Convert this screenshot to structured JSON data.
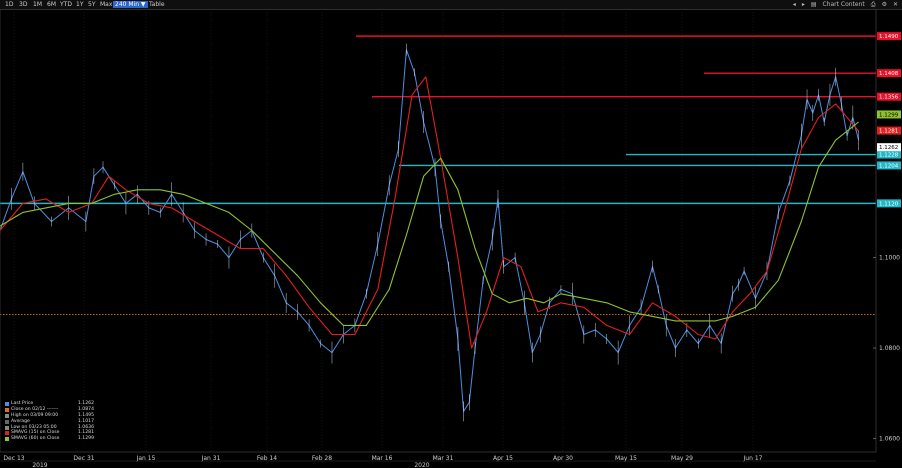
{
  "toolbar": {
    "ranges": [
      "1D",
      "3D",
      "1M",
      "6M",
      "YTD",
      "1Y",
      "5Y",
      "Max",
      "240 Min ▼",
      "Table"
    ],
    "active_range": "240 Min ▼",
    "chart_content_label": "Chart Content"
  },
  "colors": {
    "price": "#4c8fe0",
    "sma15": "#e02020",
    "sma60": "#8fc22f",
    "resistance": "#e8102a",
    "support": "#20b8c8",
    "close_ref": "#e07020"
  },
  "chart_data": {
    "type": "line",
    "x_tick_labels": [
      "Dec 13",
      "Dec 31",
      "Jan 15",
      "Jan 31",
      "Feb 14",
      "Feb 28",
      "Mar 16",
      "Mar 31",
      "Apr 15",
      "Apr 30",
      "May 15",
      "May 29",
      "Jun 17"
    ],
    "year_labels": [
      "2019",
      "2020"
    ],
    "y_tick_labels": [
      "1.1000",
      "1.0800",
      "1.0600"
    ],
    "ylim": [
      1.057,
      1.155
    ],
    "close_reference": 1.0874,
    "horizontal_levels": [
      {
        "value": 1.149,
        "label": "1.1490",
        "kind": "resistance"
      },
      {
        "value": 1.1408,
        "label": "1.1408",
        "kind": "resistance"
      },
      {
        "value": 1.1356,
        "label": "1.1356",
        "kind": "resistance"
      },
      {
        "value": 1.1228,
        "label": "1.1228",
        "kind": "support"
      },
      {
        "value": 1.1204,
        "label": "1.1204",
        "kind": "support"
      },
      {
        "value": 1.112,
        "label": "1.1120",
        "kind": "support"
      }
    ],
    "badges": [
      {
        "value": 1.1299,
        "label": "1.1299",
        "kind": "sma60"
      },
      {
        "value": 1.1281,
        "label": "1.1281",
        "kind": "sma15"
      },
      {
        "value": 1.1262,
        "label": "1.1262",
        "kind": "last"
      }
    ],
    "series": [
      {
        "name": "Last Price",
        "points": [
          [
            0,
            1.106
          ],
          [
            10,
            1.113
          ],
          [
            20,
            1.119
          ],
          [
            30,
            1.112
          ],
          [
            45,
            1.108
          ],
          [
            60,
            1.111
          ],
          [
            75,
            1.108
          ],
          [
            82,
            1.118
          ],
          [
            90,
            1.12
          ],
          [
            100,
            1.116
          ],
          [
            110,
            1.112
          ],
          [
            120,
            1.114
          ],
          [
            130,
            1.111
          ],
          [
            140,
            1.11
          ],
          [
            150,
            1.114
          ],
          [
            160,
            1.11
          ],
          [
            170,
            1.106
          ],
          [
            180,
            1.104
          ],
          [
            190,
            1.103
          ],
          [
            200,
            1.1
          ],
          [
            210,
            1.104
          ],
          [
            220,
            1.106
          ],
          [
            230,
            1.1
          ],
          [
            240,
            1.096
          ],
          [
            250,
            1.09
          ],
          [
            260,
            1.088
          ],
          [
            270,
            1.085
          ],
          [
            280,
            1.081
          ],
          [
            290,
            1.079
          ],
          [
            300,
            1.083
          ],
          [
            310,
            1.085
          ],
          [
            320,
            1.092
          ],
          [
            330,
            1.103
          ],
          [
            340,
            1.116
          ],
          [
            348,
            1.124
          ],
          [
            355,
            1.146
          ],
          [
            362,
            1.141
          ],
          [
            370,
            1.13
          ],
          [
            380,
            1.12
          ],
          [
            385,
            1.108
          ],
          [
            392,
            1.098
          ],
          [
            400,
            1.082
          ],
          [
            405,
            1.066
          ],
          [
            410,
            1.068
          ],
          [
            415,
            1.08
          ],
          [
            422,
            1.095
          ],
          [
            430,
            1.104
          ],
          [
            435,
            1.113
          ],
          [
            440,
            1.098
          ],
          [
            450,
            1.1
          ],
          [
            458,
            1.09
          ],
          [
            465,
            1.079
          ],
          [
            472,
            1.083
          ],
          [
            480,
            1.09
          ],
          [
            490,
            1.093
          ],
          [
            500,
            1.092
          ],
          [
            510,
            1.083
          ],
          [
            520,
            1.084
          ],
          [
            530,
            1.082
          ],
          [
            540,
            1.079
          ],
          [
            550,
            1.085
          ],
          [
            560,
            1.089
          ],
          [
            570,
            1.098
          ],
          [
            575,
            1.093
          ],
          [
            582,
            1.085
          ],
          [
            590,
            1.08
          ],
          [
            600,
            1.084
          ],
          [
            610,
            1.081
          ],
          [
            620,
            1.085
          ],
          [
            630,
            1.081
          ],
          [
            640,
            1.092
          ],
          [
            645,
            1.094
          ],
          [
            650,
            1.097
          ],
          [
            660,
            1.091
          ],
          [
            670,
            1.097
          ],
          [
            680,
            1.11
          ],
          [
            690,
            1.117
          ],
          [
            700,
            1.127
          ],
          [
            705,
            1.135
          ],
          [
            710,
            1.132
          ],
          [
            715,
            1.136
          ],
          [
            720,
            1.13
          ],
          [
            725,
            1.136
          ],
          [
            730,
            1.14
          ],
          [
            735,
            1.134
          ],
          [
            740,
            1.127
          ],
          [
            745,
            1.131
          ],
          [
            750,
            1.126
          ]
        ]
      },
      {
        "name": "SMAVG (15) on Close",
        "points": [
          [
            0,
            1.106
          ],
          [
            20,
            1.112
          ],
          [
            40,
            1.113
          ],
          [
            60,
            1.11
          ],
          [
            80,
            1.112
          ],
          [
            95,
            1.118
          ],
          [
            110,
            1.115
          ],
          [
            130,
            1.112
          ],
          [
            150,
            1.111
          ],
          [
            170,
            1.108
          ],
          [
            190,
            1.105
          ],
          [
            210,
            1.102
          ],
          [
            230,
            1.102
          ],
          [
            250,
            1.096
          ],
          [
            270,
            1.089
          ],
          [
            290,
            1.083
          ],
          [
            310,
            1.083
          ],
          [
            330,
            1.093
          ],
          [
            345,
            1.113
          ],
          [
            360,
            1.136
          ],
          [
            372,
            1.14
          ],
          [
            385,
            1.122
          ],
          [
            400,
            1.1
          ],
          [
            412,
            1.08
          ],
          [
            425,
            1.088
          ],
          [
            440,
            1.1
          ],
          [
            455,
            1.098
          ],
          [
            470,
            1.088
          ],
          [
            490,
            1.09
          ],
          [
            510,
            1.089
          ],
          [
            530,
            1.085
          ],
          [
            550,
            1.083
          ],
          [
            570,
            1.09
          ],
          [
            590,
            1.087
          ],
          [
            610,
            1.083
          ],
          [
            625,
            1.082
          ],
          [
            640,
            1.088
          ],
          [
            655,
            1.092
          ],
          [
            670,
            1.097
          ],
          [
            685,
            1.11
          ],
          [
            700,
            1.124
          ],
          [
            715,
            1.131
          ],
          [
            730,
            1.134
          ],
          [
            750,
            1.128
          ]
        ]
      },
      {
        "name": "SMAVG (60) on Close",
        "points": [
          [
            0,
            1.107
          ],
          [
            20,
            1.11
          ],
          [
            40,
            1.111
          ],
          [
            60,
            1.112
          ],
          [
            80,
            1.112
          ],
          [
            100,
            1.114
          ],
          [
            120,
            1.115
          ],
          [
            140,
            1.115
          ],
          [
            160,
            1.114
          ],
          [
            180,
            1.112
          ],
          [
            200,
            1.11
          ],
          [
            220,
            1.106
          ],
          [
            240,
            1.101
          ],
          [
            260,
            1.096
          ],
          [
            280,
            1.09
          ],
          [
            300,
            1.085
          ],
          [
            320,
            1.085
          ],
          [
            340,
            1.093
          ],
          [
            355,
            1.105
          ],
          [
            370,
            1.118
          ],
          [
            385,
            1.122
          ],
          [
            400,
            1.115
          ],
          [
            415,
            1.102
          ],
          [
            430,
            1.092
          ],
          [
            445,
            1.09
          ],
          [
            460,
            1.091
          ],
          [
            475,
            1.09
          ],
          [
            490,
            1.092
          ],
          [
            510,
            1.091
          ],
          [
            530,
            1.09
          ],
          [
            550,
            1.088
          ],
          [
            570,
            1.087
          ],
          [
            590,
            1.086
          ],
          [
            610,
            1.086
          ],
          [
            625,
            1.086
          ],
          [
            640,
            1.087
          ],
          [
            660,
            1.089
          ],
          [
            680,
            1.095
          ],
          [
            700,
            1.108
          ],
          [
            715,
            1.12
          ],
          [
            730,
            1.126
          ],
          [
            750,
            1.13
          ]
        ]
      }
    ]
  },
  "legend": {
    "rows": [
      {
        "label": "Last Price",
        "value": "1.1262"
      },
      {
        "label": "Close on 02/12 -------",
        "value": "1.0874"
      },
      {
        "label": "High on 03/09 09:00",
        "value": "1.1495"
      },
      {
        "label": "Average",
        "value": "1.1017"
      },
      {
        "label": "Low on 03/23 05:00",
        "value": "1.0636"
      },
      {
        "label": "SMAVG (15) on Close",
        "value": "1.1281"
      },
      {
        "label": "SMAVG (60) on Close",
        "value": "1.1299"
      }
    ]
  }
}
